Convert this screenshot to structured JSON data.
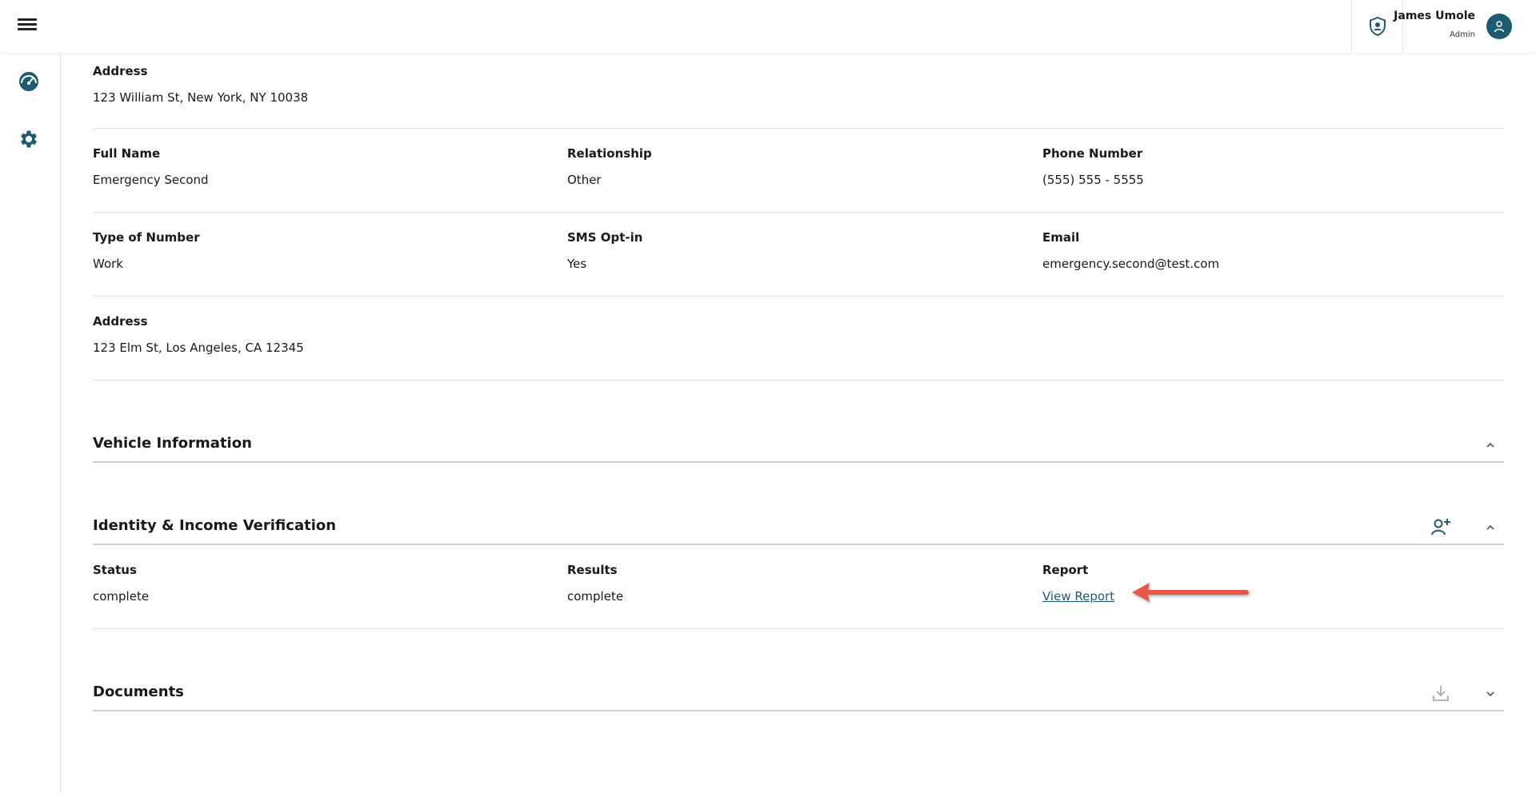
{
  "topbar": {
    "menu_icon": "hamburger-menu-icon",
    "shield_icon": "user-shield-icon",
    "user_name": "James Umole",
    "user_role": "Admin",
    "avatar_icon": "user-avatar-icon"
  },
  "sidebar": {
    "items": [
      {
        "icon": "dashboard-gauge-icon"
      },
      {
        "icon": "gear-icon"
      }
    ]
  },
  "contacts": {
    "address1": {
      "label": "Address",
      "value": "123 William St, New York, NY 10038"
    },
    "second": {
      "full_name": {
        "label": "Full Name",
        "value": "Emergency Second"
      },
      "relationship": {
        "label": "Relationship",
        "value": "Other"
      },
      "phone": {
        "label": "Phone Number",
        "value": "(555) 555 - 5555"
      },
      "type_of_number": {
        "label": "Type of Number",
        "value": "Work"
      },
      "sms_optin": {
        "label": "SMS Opt-in",
        "value": "Yes"
      },
      "email": {
        "label": "Email",
        "value": "emergency.second@test.com"
      },
      "address": {
        "label": "Address",
        "value": "123 Elm St, Los Angeles, CA 12345"
      }
    }
  },
  "sections": {
    "vehicle": {
      "title": "Vehicle Information"
    },
    "identity": {
      "title": "Identity & Income Verification",
      "status": {
        "label": "Status",
        "value": "complete"
      },
      "results": {
        "label": "Results",
        "value": "complete"
      },
      "report": {
        "label": "Report",
        "link": "View Report"
      }
    },
    "documents": {
      "title": "Documents"
    }
  },
  "colors": {
    "brand": "#1d5b73",
    "annotation_arrow": "#e8574a"
  }
}
